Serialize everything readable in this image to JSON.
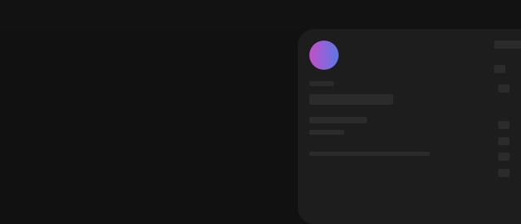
{
  "profile_card": {
    "avatar": {
      "gradient_start": "#c44fc8",
      "gradient_end": "#5b78e6"
    },
    "placeholder_color": "#2b2b2b",
    "card_color": "#1d1d1d",
    "background_color": "#111111"
  }
}
